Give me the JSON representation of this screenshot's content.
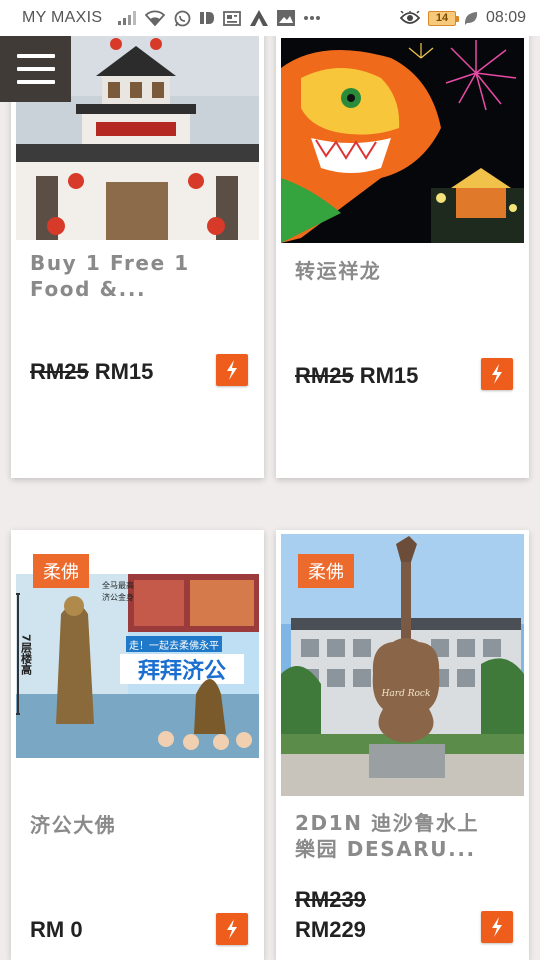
{
  "status_bar": {
    "carrier": "MY MAXIS",
    "battery": "14",
    "time": "08:09"
  },
  "cards": [
    {
      "title": "Buy 1 Free 1\nFood &...",
      "old_price": "RM25",
      "price": "RM15"
    },
    {
      "title": "转运祥龙",
      "old_price": "RM25",
      "price": "RM15"
    },
    {
      "tag": "柔佛",
      "title": "济公大佛",
      "price": "RM 0"
    },
    {
      "tag": "柔佛",
      "title": "2D1N 迪沙鲁水上\n樂园 DESARU...",
      "old_price": "RM239",
      "price": "RM229"
    }
  ],
  "poster": {
    "headline": "拜拜济公",
    "subline": "走！一起去柔佛永平",
    "floors": "7层楼高",
    "badge_text": "全马最高\n济公金身"
  },
  "colors": {
    "accent": "#ee5d1c",
    "tag_bg": "#ec6a2c",
    "menu_bg": "#413b38"
  }
}
